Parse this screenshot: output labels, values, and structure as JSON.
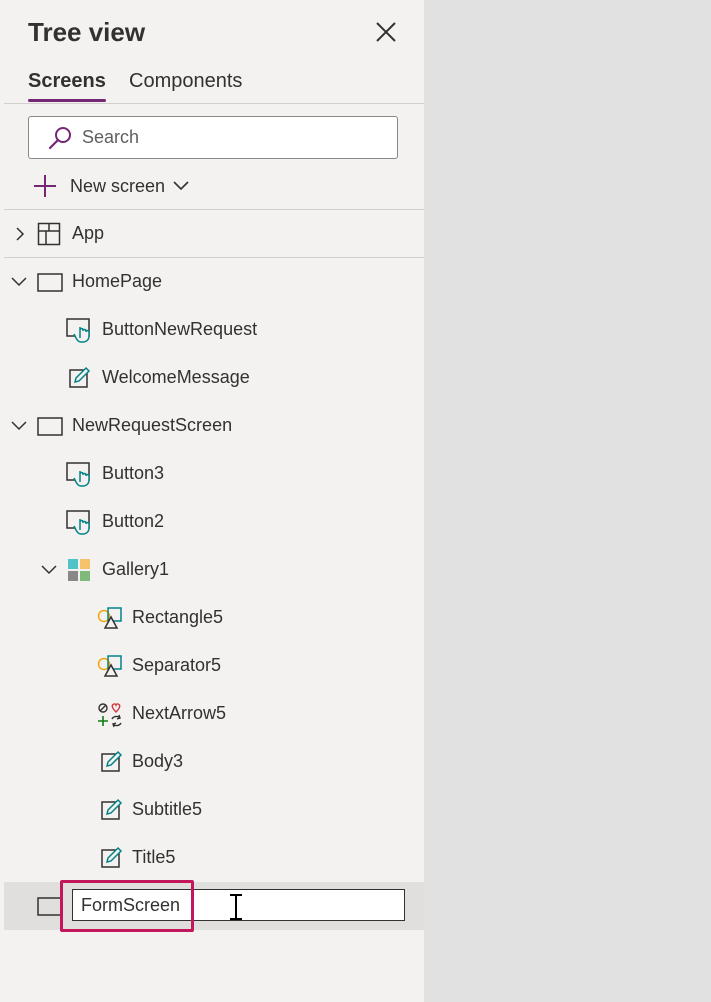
{
  "panel": {
    "title": "Tree view",
    "tabs": [
      {
        "label": "Screens",
        "active": true
      },
      {
        "label": "Components",
        "active": false
      }
    ],
    "search": {
      "placeholder": "Search",
      "value": ""
    },
    "new_screen_label": "New screen"
  },
  "tree": {
    "app": {
      "label": "App",
      "icon": "app-icon",
      "expanded": false
    },
    "nodes": [
      {
        "label": "HomePage",
        "icon": "screen-icon",
        "expanded": true
      },
      {
        "label": "ButtonNewRequest",
        "icon": "button-icon"
      },
      {
        "label": "WelcomeMessage",
        "icon": "label-icon"
      },
      {
        "label": "NewRequestScreen",
        "icon": "screen-icon",
        "expanded": true
      },
      {
        "label": "Button3",
        "icon": "button-icon"
      },
      {
        "label": "Button2",
        "icon": "button-icon"
      },
      {
        "label": "Gallery1",
        "icon": "gallery-icon",
        "expanded": true
      },
      {
        "label": "Rectangle5",
        "icon": "shape-icon"
      },
      {
        "label": "Separator5",
        "icon": "shape-icon"
      },
      {
        "label": "NextArrow5",
        "icon": "icons-icon"
      },
      {
        "label": "Body3",
        "icon": "label-icon"
      },
      {
        "label": "Subtitle5",
        "icon": "label-icon"
      },
      {
        "label": "Title5",
        "icon": "label-icon"
      }
    ],
    "renaming": {
      "value": "FormScreen",
      "icon": "screen-icon"
    }
  },
  "colors": {
    "accent": "#742774",
    "teal_icon": "#038387",
    "highlight_annotation": "#c2185b",
    "panel_bg": "#f3f2f1",
    "canvas_bg": "#e1e1e1"
  }
}
